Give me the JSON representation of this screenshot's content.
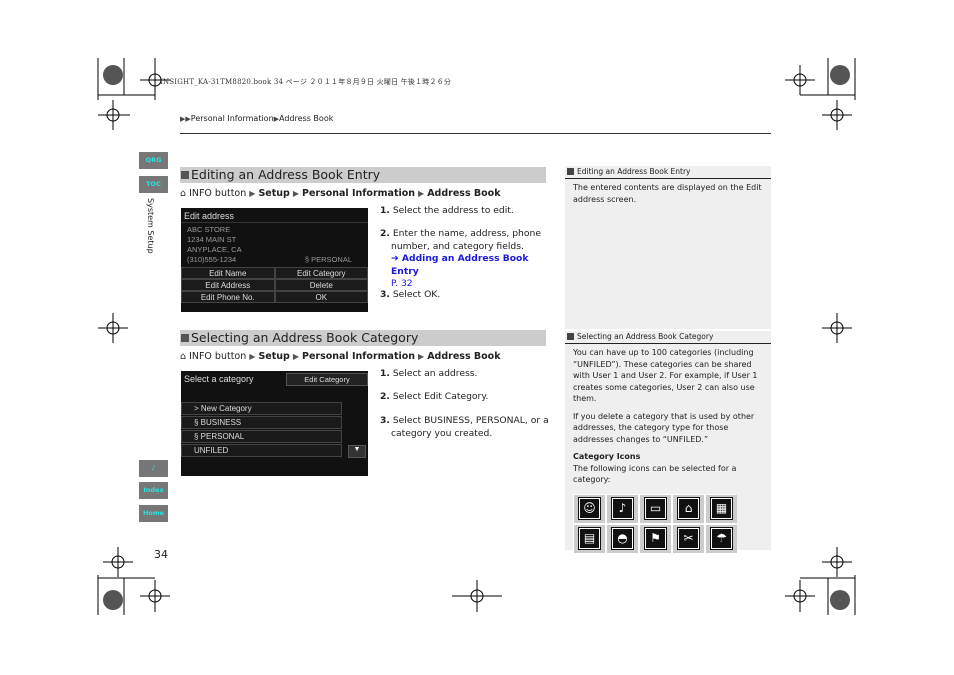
{
  "print_header": "INSIGHT_KA-31TM8820.book  34 ページ  ２０１１年８月９日  火曜日  午後１時２６分",
  "breadcrumb": [
    "Personal Information",
    "Address Book"
  ],
  "side_tabs": {
    "qrg": "QRG",
    "toc": "TOC",
    "section": "System Setup",
    "voice": "voice-icon",
    "index": "Index",
    "home": "Home"
  },
  "page_number": "34",
  "sections": [
    {
      "title": "Editing an Address Book Entry",
      "path": {
        "start": "INFO button",
        "items": [
          "Setup",
          "Personal Information",
          "Address Book"
        ]
      },
      "screen": {
        "title": "Edit address",
        "lines": [
          "ABC STORE",
          "1234 MAIN ST",
          "ANYPLACE, CA",
          "(310)555-1234"
        ],
        "category": "PERSONAL",
        "buttons": [
          [
            "Edit Name",
            "Edit Category"
          ],
          [
            "Edit Address",
            "Delete"
          ],
          [
            "Edit Phone No.",
            "OK"
          ]
        ]
      },
      "steps": [
        {
          "num": "1.",
          "text": "Select the address to edit."
        },
        {
          "num": "2.",
          "text": "Enter the name, address, phone number, and category fields.",
          "link": "Adding an Address Book Entry",
          "link_page": "P. 32"
        },
        {
          "num": "3.",
          "pre": "Select ",
          "bold": "OK",
          "post": "."
        }
      ]
    },
    {
      "title": "Selecting an Address Book Category",
      "path": {
        "start": "INFO button",
        "items": [
          "Setup",
          "Personal Information",
          "Address Book"
        ]
      },
      "screen": {
        "title": "Select a category",
        "button": "Edit Category",
        "rows": [
          "> New Category",
          "BUSINESS",
          "PERSONAL",
          "UNFILED"
        ]
      },
      "steps": [
        {
          "num": "1.",
          "text": "Select an address."
        },
        {
          "num": "2.",
          "pre": "Select ",
          "bold": "Edit Category",
          "post": "."
        },
        {
          "num": "3.",
          "pre": "Select ",
          "bold": "BUSINESS",
          "mid": ", ",
          "bold2": "PERSONAL",
          "post": ", or a category you created."
        }
      ]
    }
  ],
  "aside": [
    {
      "title": "Editing an Address Book Entry",
      "paras": [
        "The entered contents are displayed on the Edit address screen."
      ]
    },
    {
      "title": "Selecting an Address Book Category",
      "paras": [
        "You can have up to 100 categories (including “UNFILED”). These categories can be shared with User 1 and User 2. For example, if User 1 creates some categories, User 2 can also use them.",
        "If you delete a category that is used by other addresses, the category type for those addresses changes to “UNFILED.”"
      ],
      "subhead": "Category Icons",
      "subtext": "The following icons can be selected for a category:",
      "icons": [
        "person-icon",
        "music-note-icon",
        "folder-icon",
        "home-icon",
        "building-icon",
        "store-icon",
        "car-icon",
        "golf-icon",
        "food-icon",
        "umbrella-icon"
      ]
    }
  ]
}
